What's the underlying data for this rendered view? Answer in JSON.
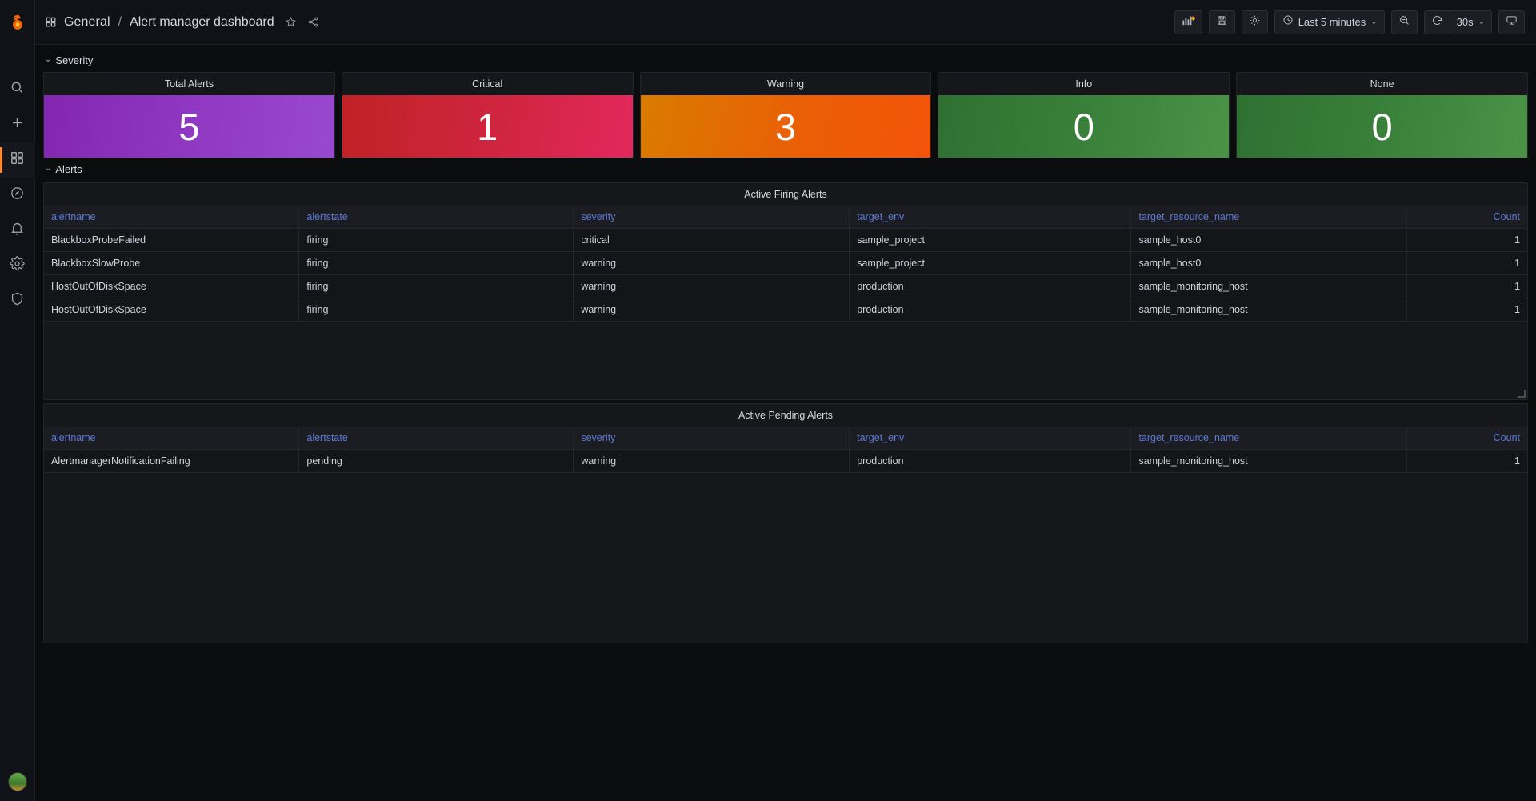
{
  "sidenav": {
    "brand_icon": "grafana-logo-icon",
    "items": [
      {
        "name": "search",
        "icon": "search-icon",
        "active": false
      },
      {
        "name": "create",
        "icon": "plus-icon",
        "active": false
      },
      {
        "name": "dashboards",
        "icon": "grid-icon",
        "active": true
      },
      {
        "name": "explore",
        "icon": "compass-icon",
        "active": false
      },
      {
        "name": "alerting",
        "icon": "bell-icon",
        "active": false
      },
      {
        "name": "configuration",
        "icon": "gear-icon",
        "active": false
      },
      {
        "name": "server-admin",
        "icon": "shield-icon",
        "active": false
      }
    ],
    "profile_label": "user-avatar"
  },
  "topbar": {
    "dashboards_icon": "grid-icon",
    "folder": "General",
    "separator": "/",
    "title": "Alert manager dashboard",
    "star_icon": "star-icon",
    "share_icon": "share-icon",
    "add_panel_icon": "add-panel-icon",
    "save_icon": "save-icon",
    "settings_icon": "gear-icon",
    "time_clock_icon": "clock-icon",
    "time_range": "Last 5 minutes",
    "time_caret": "⌄",
    "zoom_out_icon": "zoom-out-icon",
    "refresh_icon": "refresh-icon",
    "refresh_interval": "30s",
    "refresh_caret": "⌄",
    "tv_icon": "tv-mode-icon"
  },
  "rows": {
    "severity": {
      "label": "Severity",
      "chevron": "⌄"
    },
    "alerts": {
      "label": "Alerts",
      "chevron": "⌄"
    }
  },
  "severity_panels": [
    {
      "title": "Total Alerts",
      "value": "5",
      "color": "#9333c7"
    },
    {
      "title": "Critical",
      "value": "1",
      "color": "#d32b45"
    },
    {
      "title": "Warning",
      "value": "3",
      "color": "#ec6508"
    },
    {
      "title": "Info",
      "value": "0",
      "color": "#3b8440"
    },
    {
      "title": "None",
      "value": "0",
      "color": "#3b8440"
    }
  ],
  "firing_panel": {
    "title": "Active Firing Alerts",
    "columns": [
      "alertname",
      "alertstate",
      "severity",
      "target_env",
      "target_resource_name",
      "Count"
    ],
    "rows": [
      {
        "alertname": "BlackboxProbeFailed",
        "alertstate": "firing",
        "severity": "critical",
        "severity_kind": "critical",
        "target_env": "sample_project",
        "target_resource_name": "sample_host0",
        "count": "1"
      },
      {
        "alertname": "BlackboxSlowProbe",
        "alertstate": "firing",
        "severity": "warning",
        "severity_kind": "warning",
        "target_env": "sample_project",
        "target_resource_name": "sample_host0",
        "count": "1"
      },
      {
        "alertname": "HostOutOfDiskSpace",
        "alertstate": "firing",
        "severity": "warning",
        "severity_kind": "warning",
        "target_env": "production",
        "target_resource_name": "sample_monitoring_host",
        "count": "1"
      },
      {
        "alertname": "HostOutOfDiskSpace",
        "alertstate": "firing",
        "severity": "warning",
        "severity_kind": "warning",
        "target_env": "production",
        "target_resource_name": "sample_monitoring_host",
        "count": "1"
      }
    ]
  },
  "pending_panel": {
    "title": "Active Pending Alerts",
    "columns": [
      "alertname",
      "alertstate",
      "severity",
      "target_env",
      "target_resource_name",
      "Count"
    ],
    "rows": [
      {
        "alertname": "AlertmanagerNotificationFailing",
        "alertstate": "pending",
        "severity": "warning",
        "severity_kind": "warning",
        "target_env": "production",
        "target_resource_name": "sample_monitoring_host",
        "count": "1"
      }
    ]
  },
  "theme": {
    "bg": "#0b0c0e",
    "panel_bg": "#16171b",
    "accent": "#ff8a2b",
    "header_link": "#5b79d6",
    "critical": "#d32b45",
    "warning": "#ec6508",
    "ok": "#3b8440",
    "total": "#9333c7"
  }
}
